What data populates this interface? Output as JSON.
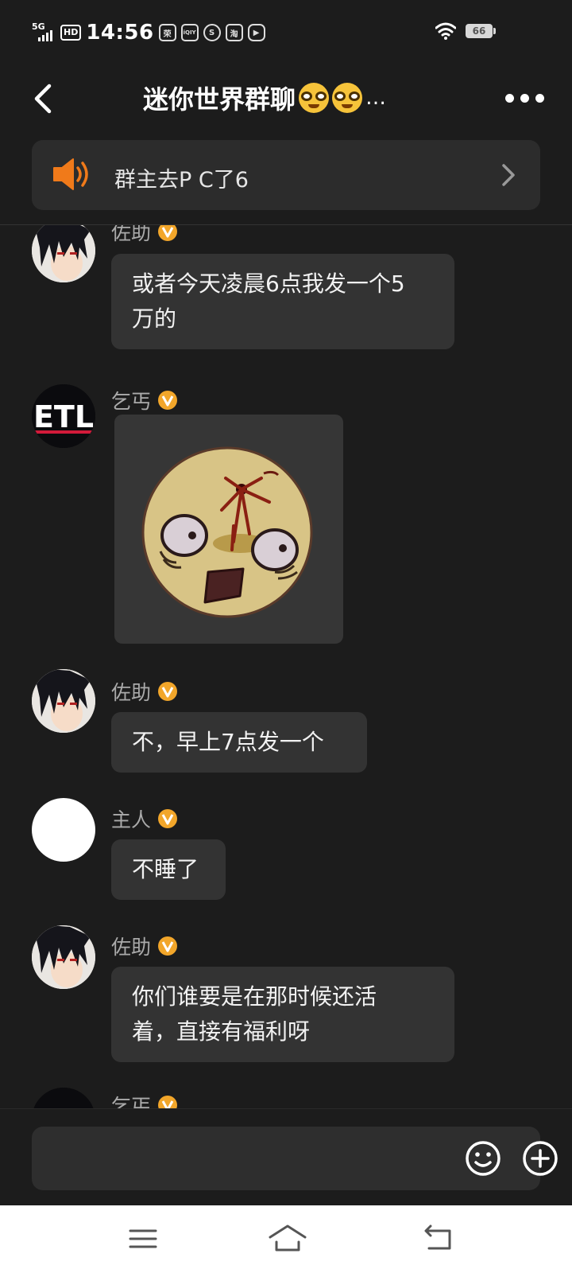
{
  "status_bar": {
    "network": "5G",
    "hd": "HD",
    "time": "14:56",
    "app_icons": [
      "news-icon",
      "iqiyi-icon",
      "weibo-icon",
      "taobao-icon",
      "video-icon"
    ],
    "app_labels": [
      "荣",
      "iQIY",
      "S",
      "淘",
      "▶"
    ],
    "battery": "66"
  },
  "header": {
    "title": "迷你世界群聊",
    "title_suffix": "…",
    "title_emojis": [
      "nerd-face",
      "nerd-face"
    ]
  },
  "announcement": {
    "text": "群主去P C了6"
  },
  "messages": [
    {
      "sender": "佐助",
      "verified": true,
      "avatar": "sasuke",
      "type": "text",
      "text": "或者今天凌晨6点我发一个5\n万的"
    },
    {
      "sender": "乞丐",
      "verified": true,
      "avatar": "etl",
      "type": "image",
      "image": "bloody-moon-face-sticker"
    },
    {
      "sender": "佐助",
      "verified": true,
      "avatar": "sasuke",
      "type": "text",
      "text": "不，早上7点发一个"
    },
    {
      "sender": "主人",
      "verified": true,
      "avatar": "blank-white",
      "type": "text",
      "text": "不睡了"
    },
    {
      "sender": "佐助",
      "verified": true,
      "avatar": "sasuke",
      "type": "text",
      "text": "你们谁要是在那时候还活\n着，直接有福利呀"
    },
    {
      "sender": "乞丐",
      "verified": true,
      "avatar": "etl",
      "type": "partial"
    }
  ],
  "colors": {
    "background": "#1c1c1c",
    "bubble": "#333333",
    "speaker_orange": "#f07a1a",
    "badge_gold": "#f2a62a"
  },
  "nav": {
    "icons": [
      "menu-icon",
      "home-icon",
      "back-nav-icon"
    ]
  }
}
